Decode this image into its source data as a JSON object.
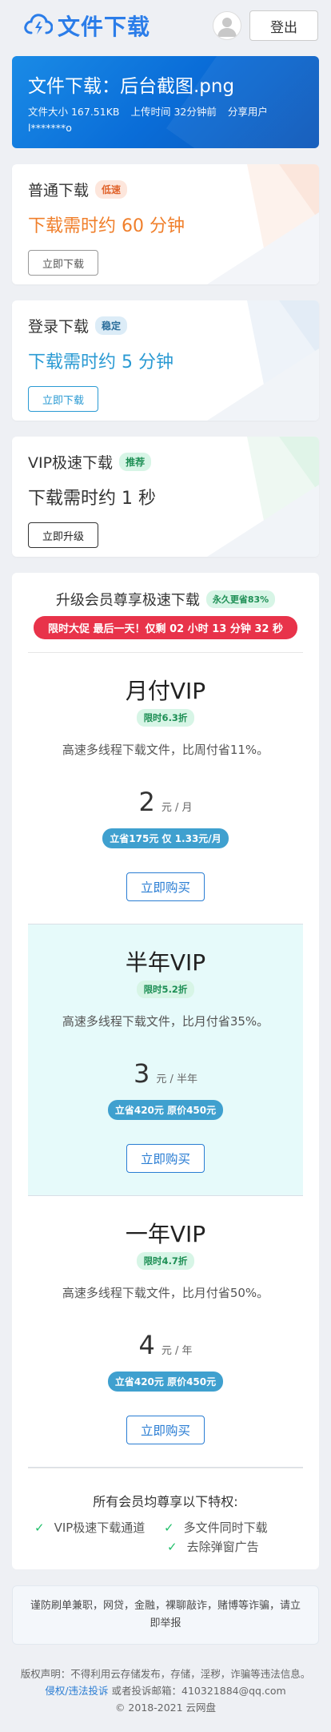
{
  "header": {
    "brand": "文件下载",
    "logout_label": "登出"
  },
  "file": {
    "title": "文件下载：后台截图.png",
    "size": "文件大小 167.51KB",
    "upload_time": "上传时间 32分钟前",
    "share_user": "分享用户 l*******o"
  },
  "options": [
    {
      "title": "普通下载",
      "tag": "低速",
      "time": "下载需时约 60 分钟",
      "button": "立即下载"
    },
    {
      "title": "登录下载",
      "tag": "稳定",
      "time": "下载需时约 5 分钟",
      "button": "立即下载"
    },
    {
      "title": "VIP极速下载",
      "tag": "推荐",
      "time": "下载需时约 1 秒",
      "button": "立即升级"
    }
  ],
  "vip": {
    "title": "升级会员尊享极速下载",
    "tag": "永久更省83%",
    "promo": "限时大促 最后一天！仅剩 02 小时 13 分钟 32 秒",
    "plans": [
      {
        "name": "月付VIP",
        "discount": "限时6.3折",
        "desc": "高速多线程下载文件，比周付省11%。",
        "price": "2",
        "unit": "元 / 月",
        "save": "立省175元 仅 1.33元/月",
        "buy": "立即购买"
      },
      {
        "name": "半年VIP",
        "discount": "限时5.2折",
        "desc": "高速多线程下载文件，比月付省35%。",
        "price": "3",
        "unit": "元 / 半年",
        "save": "立省420元 原价450元",
        "buy": "立即购买"
      },
      {
        "name": "一年VIP",
        "discount": "限时4.7折",
        "desc": "高速多线程下载文件，比月付省50%。",
        "price": "4",
        "unit": "元 / 年",
        "save": "立省420元 原价450元",
        "buy": "立即购买"
      }
    ],
    "privileges_title": "所有会员均尊享以下特权:",
    "privileges": [
      "VIP极速下载通道",
      "多文件同时下载",
      "去除弹窗广告"
    ]
  },
  "notice": "谨防刷单兼职，网贷，金融，裸聊敲诈，赌博等诈骗，请立即举报",
  "footer": {
    "disclaimer": "版权声明：不得利用云存储发布，存储，淫秽，诈骗等违法信息。",
    "report_link": "侵权/违法投诉",
    "report_email": "或者投诉邮箱：410321884@qq.com",
    "copyright": "© 2018-2021 云网盘"
  },
  "colors": {
    "brand": "#2b7de9",
    "hero_start": "#1a8be6",
    "promo_red": "#e8334a",
    "check_green": "#1fbf6a"
  }
}
